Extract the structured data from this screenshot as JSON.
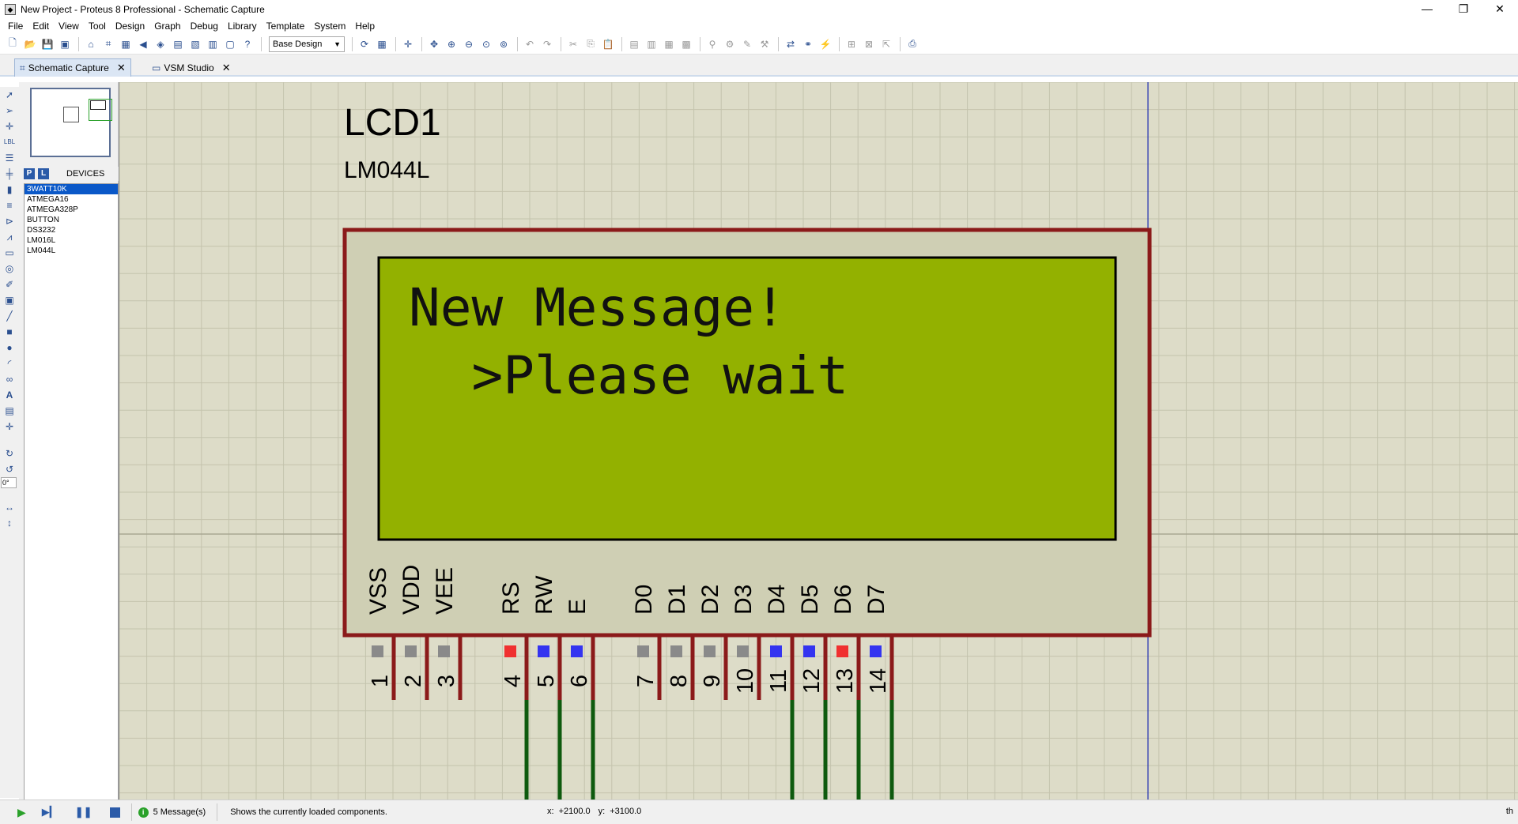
{
  "window": {
    "title": "New Project - Proteus 8 Professional - Schematic Capture",
    "minimize_icon": "minimize-icon",
    "restore_icon": "restore-icon",
    "close_icon": "close-icon"
  },
  "menu": [
    "File",
    "Edit",
    "View",
    "Tool",
    "Design",
    "Graph",
    "Debug",
    "Library",
    "Template",
    "System",
    "Help"
  ],
  "toolbar": {
    "design_select": "Base Design"
  },
  "tabs": [
    {
      "label": "Schematic Capture",
      "active": true
    },
    {
      "label": "VSM Studio",
      "active": false
    }
  ],
  "devices_panel": {
    "p_button": "P",
    "l_button": "L",
    "title": "DEVICES",
    "items": [
      "3WATT10K",
      "ATMEGA16",
      "ATMEGA328P",
      "BUTTON",
      "DS3232",
      "LM016L",
      "LM044L"
    ],
    "selected_index": 0
  },
  "rotation_angle": "0°",
  "component": {
    "reference": "LCD1",
    "part": "LM044L",
    "display_lines": [
      "New Message!",
      "  >Please wait",
      "",
      ""
    ],
    "pins": [
      {
        "number": "1",
        "name": "VSS",
        "state": "gray"
      },
      {
        "number": "2",
        "name": "VDD",
        "state": "gray"
      },
      {
        "number": "3",
        "name": "VEE",
        "state": "gray"
      },
      {
        "number": "4",
        "name": "RS",
        "state": "red"
      },
      {
        "number": "5",
        "name": "RW",
        "state": "blue"
      },
      {
        "number": "6",
        "name": "E",
        "state": "blue"
      },
      {
        "number": "7",
        "name": "D0",
        "state": "gray"
      },
      {
        "number": "8",
        "name": "D1",
        "state": "gray"
      },
      {
        "number": "9",
        "name": "D2",
        "state": "gray"
      },
      {
        "number": "10",
        "name": "D3",
        "state": "gray"
      },
      {
        "number": "11",
        "name": "D4",
        "state": "blue"
      },
      {
        "number": "12",
        "name": "D5",
        "state": "blue"
      },
      {
        "number": "13",
        "name": "D6",
        "state": "red"
      },
      {
        "number": "14",
        "name": "D7",
        "state": "blue"
      }
    ],
    "wired_pins": [
      "4",
      "5",
      "6",
      "11",
      "12",
      "13",
      "14"
    ]
  },
  "colors": {
    "canvas": "#dddcc8",
    "grid": "#c4c3ad",
    "major_grid": "#a9a893",
    "lcd_body": "#cfcfb4",
    "lcd_border": "#8b1a1a",
    "lcd_screen": "#93b100",
    "pin_wire": "#8b1a1a",
    "net_wire": "#0e5a0e",
    "state_red": "#f03030",
    "state_blue": "#3434f0",
    "state_gray": "#8a8a8a",
    "page_boundary": "#2030b0"
  },
  "status": {
    "messages": "5 Message(s)",
    "hint": "Shows the currently loaded components.",
    "x_label": "x:",
    "x_value": "+2100.0",
    "y_label": "y:",
    "y_value": "+3100.0",
    "right_text": "th"
  }
}
